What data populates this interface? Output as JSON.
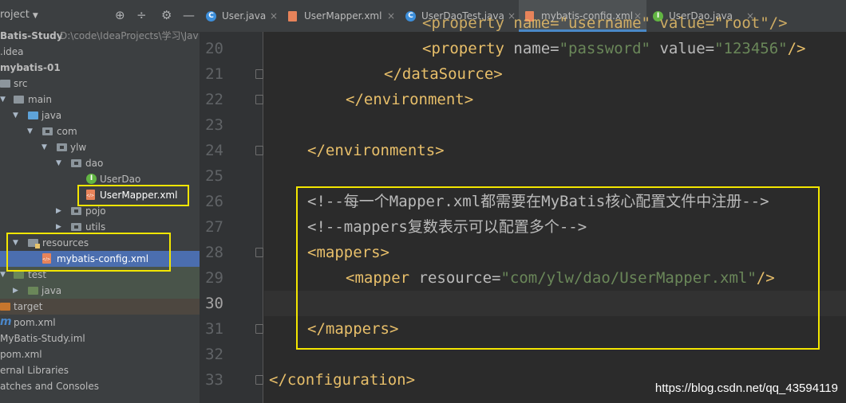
{
  "sidebar": {
    "title": "roject",
    "header_icons": [
      "target-icon",
      "collapse-icon",
      "gear-icon",
      "minimize-icon"
    ],
    "tree": [
      {
        "label": "Batis-Study",
        "sub": "D:\\code\\IdeaProjects\\学习\\Jav",
        "bold": true
      },
      {
        "label": ".idea"
      },
      {
        "label": "mybatis-01",
        "bold": true
      },
      {
        "label": "src"
      },
      {
        "label": "main"
      },
      {
        "label": "java"
      },
      {
        "label": "com"
      },
      {
        "label": "ylw"
      },
      {
        "label": "dao"
      },
      {
        "label": "UserDao"
      },
      {
        "label": "UserMapper.xml"
      },
      {
        "label": "pojo"
      },
      {
        "label": "utils"
      },
      {
        "label": "resources"
      },
      {
        "label": "mybatis-config.xml"
      },
      {
        "label": "test"
      },
      {
        "label": "java"
      },
      {
        "label": "target"
      },
      {
        "label": "pom.xml"
      },
      {
        "label": "MyBatis-Study.iml"
      },
      {
        "label": "pom.xml"
      },
      {
        "label": "ernal Libraries"
      },
      {
        "label": "atches and Consoles"
      }
    ]
  },
  "tabs": [
    {
      "label": "User.java",
      "icon": "class-icon"
    },
    {
      "label": "UserMapper.xml",
      "icon": "xml-file-icon"
    },
    {
      "label": "UserDaoTest.java",
      "icon": "class-icon"
    },
    {
      "label": "mybatis-config.xml",
      "icon": "xml-file-icon",
      "active": true
    },
    {
      "label": "UserDao.java",
      "icon": "interface-icon"
    }
  ],
  "editor": {
    "line_numbers": [
      "20",
      "21",
      "22",
      "23",
      "24",
      "25",
      "26",
      "27",
      "28",
      "29",
      "30",
      "31",
      "32",
      "33"
    ],
    "lines": {
      "l19": "<property name=\"username\" value=\"root\"/>",
      "l20_open": "<property",
      "l20_name_attr": "name=",
      "l20_name_val": "\"password\"",
      "l20_value_attr": "value=",
      "l20_value_val": "\"123456\"",
      "l20_close": "/>",
      "l21": "</dataSource>",
      "l22": "</environment>",
      "l24": "</environments>",
      "l26": "<!--每一个Mapper.xml都需要在MyBatis核心配置文件中注册-->",
      "l27": "<!--mappers复数表示可以配置多个-->",
      "l28": "<mappers>",
      "l29_open": "<mapper",
      "l29_attr": "resource=",
      "l29_val": "\"com/ylw/dao/UserMapper.xml\"",
      "l29_close": "/>",
      "l31": "</mappers>",
      "l33": "</configuration>"
    }
  },
  "watermark": "https://blog.csdn.net/qq_43594119",
  "colors": {
    "highlight_box": "#f3e600",
    "xml_tag": "#e8bf6a",
    "xml_value": "#6a8759",
    "selected_row": "#4b6eaf"
  }
}
